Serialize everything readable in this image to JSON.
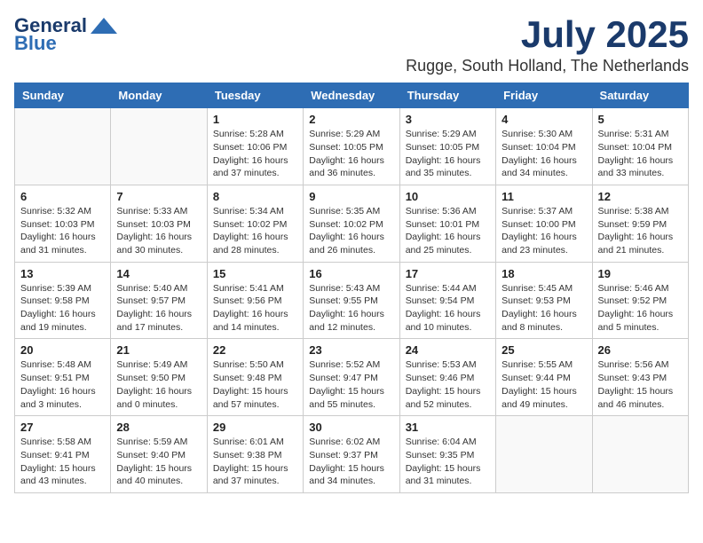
{
  "header": {
    "logo_line1": "General",
    "logo_line2": "Blue",
    "month": "July 2025",
    "location": "Rugge, South Holland, The Netherlands"
  },
  "weekdays": [
    "Sunday",
    "Monday",
    "Tuesday",
    "Wednesday",
    "Thursday",
    "Friday",
    "Saturday"
  ],
  "weeks": [
    [
      {
        "day": "",
        "content": ""
      },
      {
        "day": "",
        "content": ""
      },
      {
        "day": "1",
        "content": "Sunrise: 5:28 AM\nSunset: 10:06 PM\nDaylight: 16 hours\nand 37 minutes."
      },
      {
        "day": "2",
        "content": "Sunrise: 5:29 AM\nSunset: 10:05 PM\nDaylight: 16 hours\nand 36 minutes."
      },
      {
        "day": "3",
        "content": "Sunrise: 5:29 AM\nSunset: 10:05 PM\nDaylight: 16 hours\nand 35 minutes."
      },
      {
        "day": "4",
        "content": "Sunrise: 5:30 AM\nSunset: 10:04 PM\nDaylight: 16 hours\nand 34 minutes."
      },
      {
        "day": "5",
        "content": "Sunrise: 5:31 AM\nSunset: 10:04 PM\nDaylight: 16 hours\nand 33 minutes."
      }
    ],
    [
      {
        "day": "6",
        "content": "Sunrise: 5:32 AM\nSunset: 10:03 PM\nDaylight: 16 hours\nand 31 minutes."
      },
      {
        "day": "7",
        "content": "Sunrise: 5:33 AM\nSunset: 10:03 PM\nDaylight: 16 hours\nand 30 minutes."
      },
      {
        "day": "8",
        "content": "Sunrise: 5:34 AM\nSunset: 10:02 PM\nDaylight: 16 hours\nand 28 minutes."
      },
      {
        "day": "9",
        "content": "Sunrise: 5:35 AM\nSunset: 10:02 PM\nDaylight: 16 hours\nand 26 minutes."
      },
      {
        "day": "10",
        "content": "Sunrise: 5:36 AM\nSunset: 10:01 PM\nDaylight: 16 hours\nand 25 minutes."
      },
      {
        "day": "11",
        "content": "Sunrise: 5:37 AM\nSunset: 10:00 PM\nDaylight: 16 hours\nand 23 minutes."
      },
      {
        "day": "12",
        "content": "Sunrise: 5:38 AM\nSunset: 9:59 PM\nDaylight: 16 hours\nand 21 minutes."
      }
    ],
    [
      {
        "day": "13",
        "content": "Sunrise: 5:39 AM\nSunset: 9:58 PM\nDaylight: 16 hours\nand 19 minutes."
      },
      {
        "day": "14",
        "content": "Sunrise: 5:40 AM\nSunset: 9:57 PM\nDaylight: 16 hours\nand 17 minutes."
      },
      {
        "day": "15",
        "content": "Sunrise: 5:41 AM\nSunset: 9:56 PM\nDaylight: 16 hours\nand 14 minutes."
      },
      {
        "day": "16",
        "content": "Sunrise: 5:43 AM\nSunset: 9:55 PM\nDaylight: 16 hours\nand 12 minutes."
      },
      {
        "day": "17",
        "content": "Sunrise: 5:44 AM\nSunset: 9:54 PM\nDaylight: 16 hours\nand 10 minutes."
      },
      {
        "day": "18",
        "content": "Sunrise: 5:45 AM\nSunset: 9:53 PM\nDaylight: 16 hours\nand 8 minutes."
      },
      {
        "day": "19",
        "content": "Sunrise: 5:46 AM\nSunset: 9:52 PM\nDaylight: 16 hours\nand 5 minutes."
      }
    ],
    [
      {
        "day": "20",
        "content": "Sunrise: 5:48 AM\nSunset: 9:51 PM\nDaylight: 16 hours\nand 3 minutes."
      },
      {
        "day": "21",
        "content": "Sunrise: 5:49 AM\nSunset: 9:50 PM\nDaylight: 16 hours\nand 0 minutes."
      },
      {
        "day": "22",
        "content": "Sunrise: 5:50 AM\nSunset: 9:48 PM\nDaylight: 15 hours\nand 57 minutes."
      },
      {
        "day": "23",
        "content": "Sunrise: 5:52 AM\nSunset: 9:47 PM\nDaylight: 15 hours\nand 55 minutes."
      },
      {
        "day": "24",
        "content": "Sunrise: 5:53 AM\nSunset: 9:46 PM\nDaylight: 15 hours\nand 52 minutes."
      },
      {
        "day": "25",
        "content": "Sunrise: 5:55 AM\nSunset: 9:44 PM\nDaylight: 15 hours\nand 49 minutes."
      },
      {
        "day": "26",
        "content": "Sunrise: 5:56 AM\nSunset: 9:43 PM\nDaylight: 15 hours\nand 46 minutes."
      }
    ],
    [
      {
        "day": "27",
        "content": "Sunrise: 5:58 AM\nSunset: 9:41 PM\nDaylight: 15 hours\nand 43 minutes."
      },
      {
        "day": "28",
        "content": "Sunrise: 5:59 AM\nSunset: 9:40 PM\nDaylight: 15 hours\nand 40 minutes."
      },
      {
        "day": "29",
        "content": "Sunrise: 6:01 AM\nSunset: 9:38 PM\nDaylight: 15 hours\nand 37 minutes."
      },
      {
        "day": "30",
        "content": "Sunrise: 6:02 AM\nSunset: 9:37 PM\nDaylight: 15 hours\nand 34 minutes."
      },
      {
        "day": "31",
        "content": "Sunrise: 6:04 AM\nSunset: 9:35 PM\nDaylight: 15 hours\nand 31 minutes."
      },
      {
        "day": "",
        "content": ""
      },
      {
        "day": "",
        "content": ""
      }
    ]
  ]
}
